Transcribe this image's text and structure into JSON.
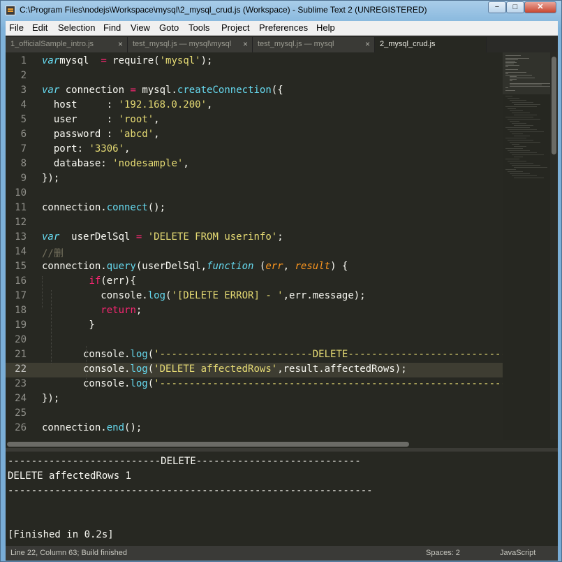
{
  "window": {
    "title": "C:\\Program Files\\nodejs\\Workspace\\mysql\\2_mysql_crud.js (Workspace) - Sublime Text 2 (UNREGISTERED)",
    "minimize_glyph": "−",
    "maximize_glyph": "□",
    "close_glyph": "✕"
  },
  "menu": [
    "File",
    "Edit",
    "Selection",
    "Find",
    "View",
    "Goto",
    "Tools",
    "Project",
    "Preferences",
    "Help"
  ],
  "tabs": [
    {
      "label": "1_officialSample_intro.js",
      "close": "×",
      "active": false
    },
    {
      "label": "test_mysql.js — mysql\\mysql",
      "close": "×",
      "active": false
    },
    {
      "label": "test_mysql.js — mysql",
      "close": "×",
      "active": false
    },
    {
      "label": "2_mysql_crud.js",
      "close": "",
      "active": true
    }
  ],
  "editor": {
    "line_numbers": [
      "1",
      "2",
      "3",
      "4",
      "5",
      "6",
      "7",
      "8",
      "9",
      "10",
      "11",
      "12",
      "13",
      "14",
      "15",
      "16",
      "17",
      "18",
      "19",
      "20",
      "21",
      "22",
      "23",
      "24",
      "25",
      "26"
    ],
    "current_line": "22",
    "lines": [
      [
        [
          "kw",
          "var"
        ],
        [
          "",
          "mysql  "
        ],
        [
          "kp",
          "="
        ],
        [
          "",
          " require("
        ],
        [
          "str",
          "'mysql'"
        ],
        [
          "",
          ");"
        ]
      ],
      [],
      [
        [
          "kw",
          "var"
        ],
        [
          "",
          " connection "
        ],
        [
          "kp",
          "="
        ],
        [
          "",
          " mysql."
        ],
        [
          "fn",
          "createConnection"
        ],
        [
          "",
          "({"
        ]
      ],
      [
        [
          "",
          "  host     : "
        ],
        [
          "str",
          "'192.168.0.200'"
        ],
        [
          "",
          ","
        ]
      ],
      [
        [
          "",
          "  user     : "
        ],
        [
          "str",
          "'root'"
        ],
        [
          "",
          ","
        ]
      ],
      [
        [
          "",
          "  password : "
        ],
        [
          "str",
          "'abcd'"
        ],
        [
          "",
          ","
        ]
      ],
      [
        [
          "",
          "  port: "
        ],
        [
          "str",
          "'3306'"
        ],
        [
          "",
          ","
        ]
      ],
      [
        [
          "",
          "  database: "
        ],
        [
          "str",
          "'nodesample'"
        ],
        [
          "",
          ","
        ]
      ],
      [
        [
          "",
          "});"
        ]
      ],
      [],
      [
        [
          "",
          "connection."
        ],
        [
          "fn",
          "connect"
        ],
        [
          "",
          "();"
        ]
      ],
      [],
      [
        [
          "kw",
          "var"
        ],
        [
          "",
          "  userDelSql "
        ],
        [
          "kp",
          "="
        ],
        [
          "",
          " "
        ],
        [
          "str",
          "'DELETE FROM userinfo'"
        ],
        [
          "",
          ";"
        ]
      ],
      [
        [
          "cm",
          "//删"
        ]
      ],
      [
        [
          "",
          "connection."
        ],
        [
          "fn",
          "query"
        ],
        [
          "",
          "(userDelSql,"
        ],
        [
          "kw",
          "function"
        ],
        [
          "",
          " ("
        ],
        [
          "prm",
          "err"
        ],
        [
          "",
          ", "
        ],
        [
          "prm",
          "result"
        ],
        [
          "",
          ") {"
        ]
      ],
      [
        [
          "",
          "        "
        ],
        [
          "kp",
          "if"
        ],
        [
          "",
          "(err){"
        ]
      ],
      [
        [
          "",
          "          console."
        ],
        [
          "fn",
          "log"
        ],
        [
          "",
          "("
        ],
        [
          "str",
          "'[DELETE ERROR] - '"
        ],
        [
          "",
          ",err.message);"
        ]
      ],
      [
        [
          "",
          "          "
        ],
        [
          "kp",
          "return"
        ],
        [
          "",
          ";"
        ]
      ],
      [
        [
          "",
          "        }"
        ]
      ],
      [],
      [
        [
          "",
          "       console."
        ],
        [
          "fn",
          "log"
        ],
        [
          "",
          "("
        ],
        [
          "str",
          "'--------------------------DELETE----------------------------"
        ]
      ],
      [
        [
          "",
          "       console."
        ],
        [
          "fn",
          "log"
        ],
        [
          "",
          "("
        ],
        [
          "str",
          "'DELETE affectedRows'"
        ],
        [
          "",
          ",result.affectedRows);"
        ]
      ],
      [
        [
          "",
          "       console."
        ],
        [
          "fn",
          "log"
        ],
        [
          "",
          "("
        ],
        [
          "str",
          "'------------------------------------------------------------"
        ]
      ],
      [
        [
          "",
          "});"
        ]
      ],
      [],
      [
        [
          "",
          "connection."
        ],
        [
          "fn",
          "end"
        ],
        [
          "",
          "();"
        ]
      ]
    ]
  },
  "console": {
    "lines": [
      "--------------------------DELETE----------------------------",
      "DELETE affectedRows 1",
      "--------------------------------------------------------------",
      "",
      "",
      "[Finished in 0.2s]"
    ]
  },
  "status": {
    "position": "Line 22, Column 63; Build finished",
    "indent": "Spaces: 2",
    "syntax": "JavaScript"
  },
  "colors": {
    "editor_bg": "#272822",
    "keyword": "#66d9ef",
    "operator": "#f92672",
    "string": "#e6db74",
    "param": "#fd971f",
    "comment": "#75715e"
  }
}
